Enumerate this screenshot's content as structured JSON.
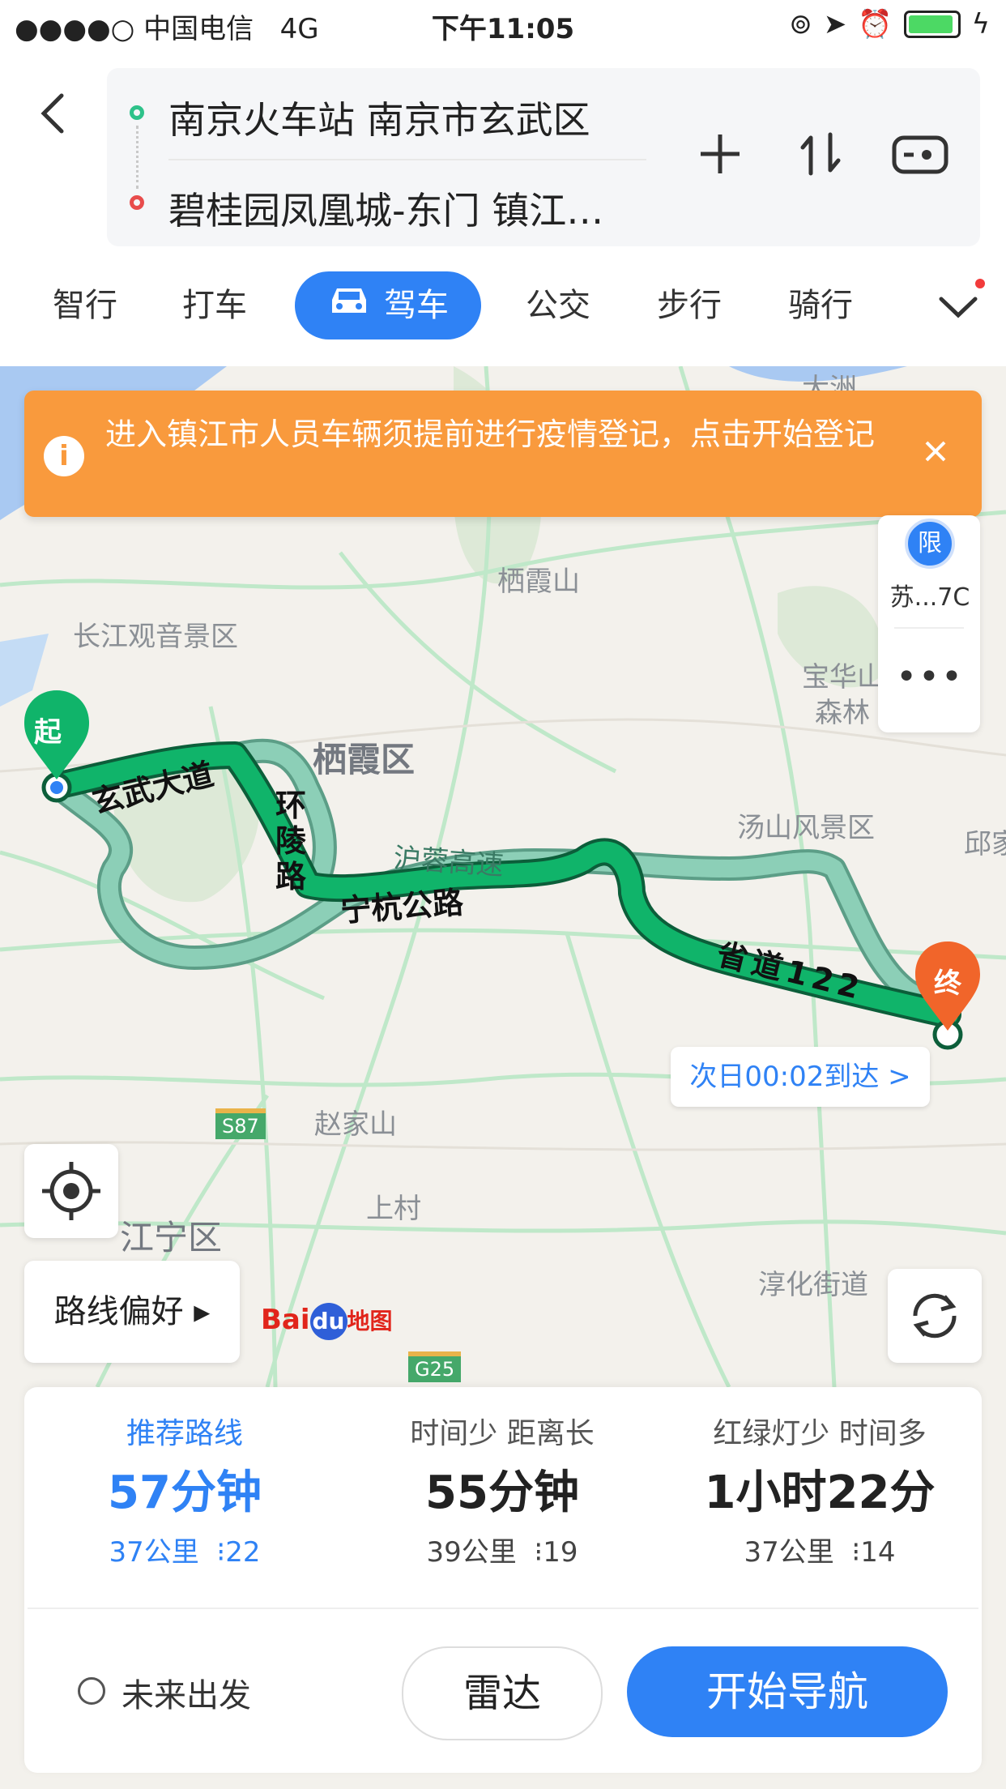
{
  "status_bar": {
    "carrier": "●●●●○ 中国电信",
    "network": "4G",
    "time": "下午11:05"
  },
  "header": {
    "origin": "南京火车站 南京市玄武区",
    "destination": "碧桂园凤凰城-东门 镇江…"
  },
  "tabs": [
    {
      "label": "智行"
    },
    {
      "label": "打车"
    },
    {
      "label": "驾车"
    },
    {
      "label": "公交"
    },
    {
      "label": "步行"
    },
    {
      "label": "骑行"
    }
  ],
  "notice": {
    "text": "进入镇江市人员车辆须提前进行疫情登记，点击开始登记"
  },
  "side_panel": {
    "restrict_label": "限",
    "plate": "苏...7C",
    "more": "•••"
  },
  "map": {
    "labels": {
      "changjiang": "长江观音景区",
      "qixiashan": "栖霞山",
      "qixiaqu": "栖霞区",
      "baohua": "宝华山",
      "senlin": "森林",
      "tangshan": "汤山风景区",
      "qiu": "邱家",
      "dazhou": "大洲",
      "zhaojiashan": "赵家山",
      "shangcun": "上村",
      "jiangning": "江宁区",
      "chunhua": "淳化街道"
    },
    "roads": {
      "xuanwu": "玄武大道",
      "huanling": "环陵路",
      "huronggaosu": "沪蓉高速",
      "ninghang": "宁杭公路",
      "shengdao": "省道122"
    },
    "shields": {
      "s87": "S87",
      "g25": "G25"
    },
    "start_marker": "起",
    "end_marker": "终",
    "eta": "次日00:02到达 >",
    "route_pref": "路线偏好 ▸",
    "logo": {
      "bai": "Bai",
      "du": "du",
      "map": "地图"
    }
  },
  "routes": [
    {
      "tag": "推荐路线",
      "time": "57分钟",
      "distance": "37公里",
      "lights": "22"
    },
    {
      "tag": "时间少  距离长",
      "time": "55分钟",
      "distance": "39公里",
      "lights": "19"
    },
    {
      "tag": "红绿灯少  时间多",
      "time": "1小时22分",
      "distance": "37公里",
      "lights": "14"
    }
  ],
  "actions": {
    "future": "未来出发",
    "radar": "雷达",
    "navigate": "开始导航"
  },
  "colors": {
    "accent": "#2f82f5",
    "route_main": "#10b46a",
    "route_alt": "#8ccfb7",
    "notice": "#f99a3d"
  }
}
